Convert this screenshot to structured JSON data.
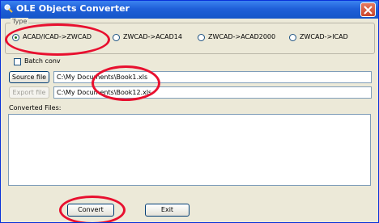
{
  "window": {
    "title": "OLE Objects Converter",
    "close_icon": "close-icon"
  },
  "type_group": {
    "label": "Type",
    "options": [
      {
        "label": "ACAD/ICAD->ZWCAD",
        "selected": true
      },
      {
        "label": "ZWCAD->ACAD14",
        "selected": false
      },
      {
        "label": "ZWCAD->ACAD2000",
        "selected": false
      },
      {
        "label": "ZWCAD->ICAD",
        "selected": false
      }
    ]
  },
  "batch_convert": {
    "label": "Batch conv",
    "checked": false
  },
  "source": {
    "button": "Source file",
    "value": "C:\\My Documents\\Book1.xls"
  },
  "export": {
    "button": "Export file",
    "value": "C:\\My Documents\\Book12.xls",
    "enabled": false
  },
  "converted_files": {
    "label": "Converted Files:"
  },
  "buttons": {
    "convert": "Convert",
    "exit": "Exit"
  },
  "colors": {
    "title_bar": "#1f5fd8",
    "annotation": "#e8102f",
    "face": "#ece9d8"
  }
}
